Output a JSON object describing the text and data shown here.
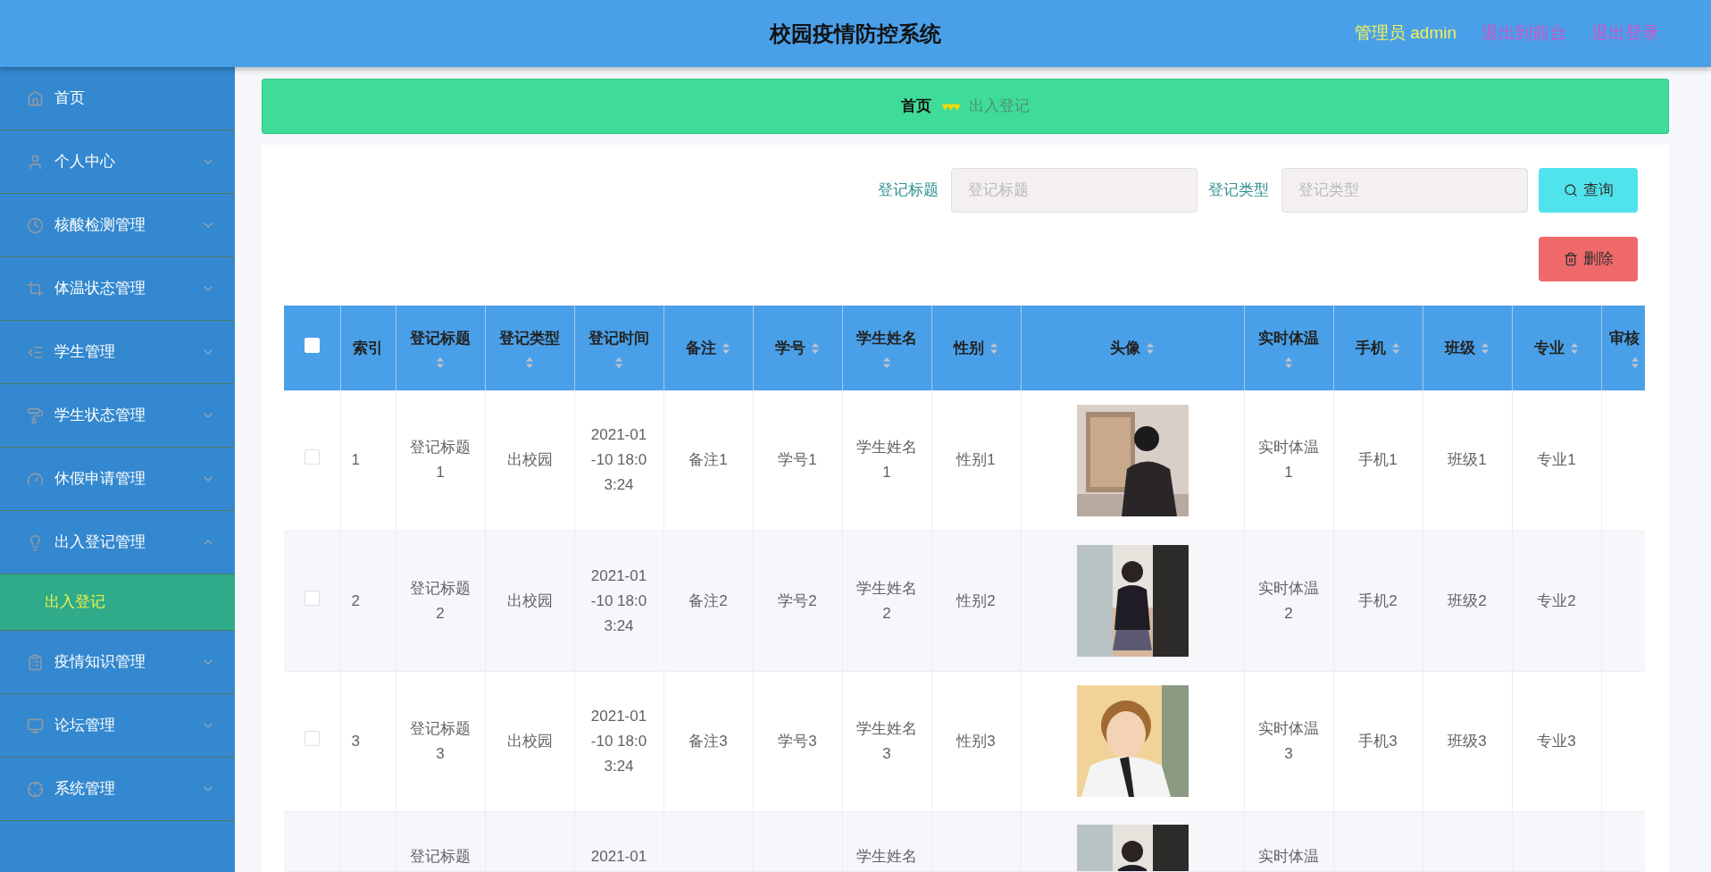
{
  "header": {
    "title": "校园疫情防控系统",
    "user": "管理员 admin",
    "links": [
      "退出到前台",
      "退出登录"
    ]
  },
  "sidebar": {
    "items": [
      {
        "label": "首页",
        "kind": "link"
      },
      {
        "label": "个人中心",
        "kind": "menu",
        "expanded": false
      },
      {
        "label": "核酸检测管理",
        "kind": "menu",
        "expanded": false
      },
      {
        "label": "体温状态管理",
        "kind": "menu",
        "expanded": false
      },
      {
        "label": "学生管理",
        "kind": "menu",
        "expanded": false
      },
      {
        "label": "学生状态管理",
        "kind": "menu",
        "expanded": false
      },
      {
        "label": "休假申请管理",
        "kind": "menu",
        "expanded": false
      },
      {
        "label": "出入登记管理",
        "kind": "menu",
        "expanded": true,
        "children": [
          {
            "label": "出入登记",
            "selected": true
          }
        ]
      },
      {
        "label": "疫情知识管理",
        "kind": "menu",
        "expanded": false
      },
      {
        "label": "论坛管理",
        "kind": "menu",
        "expanded": false
      },
      {
        "label": "系统管理",
        "kind": "menu",
        "expanded": false
      }
    ]
  },
  "breadcrumb": {
    "home": "首页",
    "separator": "♥♥♥",
    "current": "出入登记"
  },
  "search": {
    "fields": [
      {
        "label": "登记标题",
        "placeholder": "登记标题"
      },
      {
        "label": "登记类型",
        "placeholder": "登记类型"
      }
    ],
    "query_button": "查询",
    "delete_button": "删除"
  },
  "table": {
    "select_all_checked": false,
    "columns": [
      {
        "label": "索引",
        "sortable": false
      },
      {
        "label": "登记标题",
        "sortable": true
      },
      {
        "label": "登记类型",
        "sortable": true
      },
      {
        "label": "登记时间",
        "sortable": true
      },
      {
        "label": "备注",
        "sortable": true
      },
      {
        "label": "学号",
        "sortable": true
      },
      {
        "label": "学生姓名",
        "sortable": true
      },
      {
        "label": "性别",
        "sortable": true
      },
      {
        "label": "头像",
        "sortable": true
      },
      {
        "label": "实时体温",
        "sortable": true
      },
      {
        "label": "手机",
        "sortable": true
      },
      {
        "label": "班级",
        "sortable": true
      },
      {
        "label": "专业",
        "sortable": true
      },
      {
        "label": "审核",
        "sortable": true
      }
    ],
    "rows": [
      {
        "kind": "full",
        "checked": false,
        "cells": [
          "1",
          "登记标题1",
          "出校园",
          "2021-01-10 18:03:24",
          "备注1",
          "学号1",
          "学生姓名1",
          "性别1",
          {
            "kind": "picture"
          },
          "实时体温1",
          "手机1",
          "班级1",
          "专业1",
          null
        ]
      },
      {
        "kind": "full",
        "checked": false,
        "cells": [
          "2",
          "登记标题2",
          "出校园",
          "2021-01-10 18:03:24",
          "备注2",
          "学号2",
          "学生姓名2",
          "性别2",
          {
            "kind": "picture"
          },
          "实时体温2",
          "手机2",
          "班级2",
          "专业2",
          null
        ]
      },
      {
        "kind": "full",
        "checked": false,
        "cells": [
          "3",
          "登记标题3",
          "出校园",
          "2021-01-10 18:03:24",
          "备注3",
          "学号3",
          "学生姓名3",
          "性别3",
          {
            "kind": "picture"
          },
          "实时体温3",
          "手机3",
          "班级3",
          "专业3",
          null
        ]
      },
      {
        "kind": "cut",
        "cells": [
          null,
          "登记标题",
          null,
          "2021-01",
          null,
          null,
          "学生姓名",
          null,
          {
            "kind": "picture"
          },
          "实时体温",
          null,
          null,
          null,
          null
        ]
      }
    ]
  }
}
